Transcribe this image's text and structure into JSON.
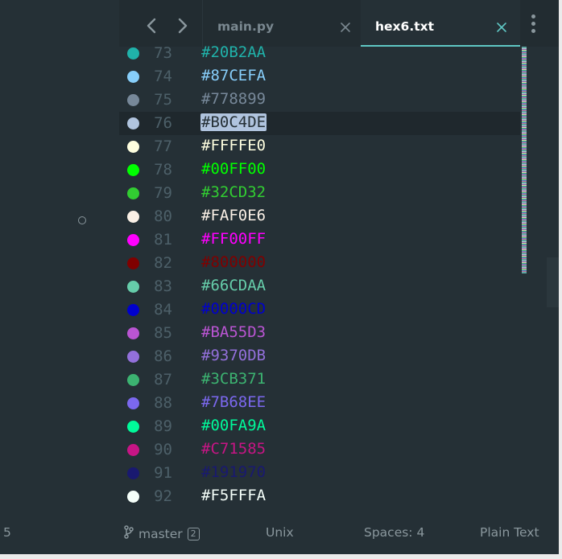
{
  "tabs": [
    {
      "label": "main.py",
      "active": false
    },
    {
      "label": "hex6.txt",
      "active": true
    }
  ],
  "editor": {
    "current_line": 76,
    "lines": [
      {
        "number": "73",
        "text": "#20B2AA",
        "color": "#20B2AA"
      },
      {
        "number": "74",
        "text": "#87CEFA",
        "color": "#87CEFA"
      },
      {
        "number": "75",
        "text": "#778899",
        "color": "#778899"
      },
      {
        "number": "76",
        "text": "#B0C4DE",
        "color": "#B0C4DE"
      },
      {
        "number": "77",
        "text": "#FFFFE0",
        "color": "#FFFFE0"
      },
      {
        "number": "78",
        "text": "#00FF00",
        "color": "#00FF00"
      },
      {
        "number": "79",
        "text": "#32CD32",
        "color": "#32CD32"
      },
      {
        "number": "80",
        "text": "#FAF0E6",
        "color": "#FAF0E6"
      },
      {
        "number": "81",
        "text": "#FF00FF",
        "color": "#FF00FF"
      },
      {
        "number": "82",
        "text": "#800000",
        "color": "#800000"
      },
      {
        "number": "83",
        "text": "#66CDAA",
        "color": "#66CDAA"
      },
      {
        "number": "84",
        "text": "#0000CD",
        "color": "#0000CD"
      },
      {
        "number": "85",
        "text": "#BA55D3",
        "color": "#BA55D3"
      },
      {
        "number": "86",
        "text": "#9370DB",
        "color": "#9370DB"
      },
      {
        "number": "87",
        "text": "#3CB371",
        "color": "#3CB371"
      },
      {
        "number": "88",
        "text": "#7B68EE",
        "color": "#7B68EE"
      },
      {
        "number": "89",
        "text": "#00FA9A",
        "color": "#00FA9A"
      },
      {
        "number": "90",
        "text": "#C71585",
        "color": "#C71585"
      },
      {
        "number": "91",
        "text": "#191970",
        "color": "#191970"
      },
      {
        "number": "92",
        "text": "#F5FFFA",
        "color": "#F5FFFA"
      }
    ]
  },
  "statusbar": {
    "line_indicator": "5",
    "branch": "master",
    "branch_count": "2",
    "line_ending": "Unix",
    "indentation": "Spaces: 4",
    "syntax": "Plain Text"
  },
  "icons": {
    "back": "chevron-left-icon",
    "forward": "chevron-right-icon",
    "close": "close-icon",
    "menu": "more-vertical-icon",
    "branch": "git-branch-icon"
  },
  "colors": {
    "background": "#253036",
    "accent": "#5fc7c4",
    "muted_text": "#8a979d"
  }
}
